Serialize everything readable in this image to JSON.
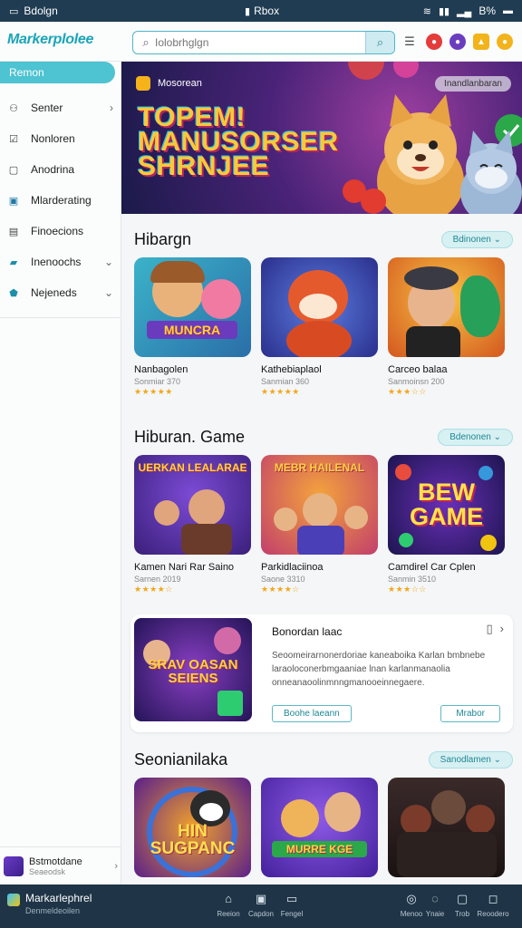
{
  "status_bar": {
    "left_text": "Bdolgn",
    "center_text": "Rbox",
    "battery_text": "B%"
  },
  "top_bar": {
    "logo": "Markerplolee",
    "search": {
      "value": "",
      "placeholder": "Iolobrhglgn"
    }
  },
  "sidebar": {
    "active": "Remon",
    "items": [
      {
        "label": "Senter",
        "icon": "person-icon",
        "has_chevron": "›"
      },
      {
        "label": "Nonloren",
        "icon": "checklist-icon",
        "has_chevron": ""
      },
      {
        "label": "Anodrina",
        "icon": "document-icon",
        "has_chevron": ""
      },
      {
        "label": "Mlarderating",
        "icon": "image-icon",
        "has_chevron": ""
      },
      {
        "label": "Finoecions",
        "icon": "finance-icon",
        "has_chevron": ""
      },
      {
        "label": "Inenoochs",
        "icon": "folder-icon",
        "has_chevron": "⌄"
      },
      {
        "label": "Nejeneds",
        "icon": "tag-icon",
        "has_chevron": "⌄"
      }
    ],
    "profile": {
      "name": "Bstmotdane",
      "sub": "Seaeodsk"
    }
  },
  "hero": {
    "tag": "Mosorean",
    "pill": "Inandlanbaran",
    "title": "TOPEM! MANUSORSER SHRNJEE"
  },
  "sections": [
    {
      "title": "Hibargn",
      "more": "Bdinonen",
      "cards": [
        {
          "name": "Nanbagolen",
          "sub": "Sonmiar 370",
          "stars": "★★★★★",
          "art_text": "MUNCRA"
        },
        {
          "name": "Kathebiaplaol",
          "sub": "Sanmian 360",
          "stars": "★★★★★",
          "art_text": ""
        },
        {
          "name": "Carceo balaa",
          "sub": "Sanmoinsn 200",
          "stars": "★★★☆☆",
          "art_text": ""
        }
      ]
    },
    {
      "title": "Hiburan. Game",
      "more": "Bdenonen",
      "cards": [
        {
          "name": "Kamen Nari Rar Saino",
          "sub": "Sarnen 2019",
          "stars": "★★★★☆",
          "art_text": "UERKAN LEALARAE"
        },
        {
          "name": "Parkidlaciinoa",
          "sub": "Saone 3310",
          "stars": "★★★★☆",
          "art_text": "MEBR HAILENAL"
        },
        {
          "name": "Camdirel Car Cplen",
          "sub": "Sanmin 3510",
          "stars": "★★★☆☆",
          "art_text": "BEW GAME"
        }
      ]
    },
    {
      "title": "Seonianilaka",
      "more": "Sanodlamen",
      "cards": [
        {
          "name": "",
          "sub": "",
          "stars": "",
          "art_text": "HIN SUGPANC"
        },
        {
          "name": "",
          "sub": "",
          "stars": "",
          "art_text": "MURRE KGE"
        },
        {
          "name": "",
          "sub": "",
          "stars": "",
          "art_text": ""
        }
      ]
    }
  ],
  "feature": {
    "title": "Bonordan laac",
    "desc": "Seoomeirarnonerdoriae kaneaboika Karlan bmbnebe laraoloconerbmgaaniae lnan karlanmanaolia onneanaoolinmnngmanooeinnegaere.",
    "btn_primary": "Boohe laeann",
    "btn_secondary": "Mrabor",
    "art_text": "SRAV OASAN SEIENS"
  },
  "bottom_bar": {
    "brand": "Markarlephrel",
    "brand_sub": "Denmeldeoilen",
    "nav_left": [
      {
        "label": "Reeion",
        "icon": "home-icon"
      },
      {
        "label": "Capdon",
        "icon": "calendar-icon"
      },
      {
        "label": "Fengel",
        "icon": "inbox-icon"
      }
    ],
    "nav_right": [
      {
        "label": "Menoo",
        "icon": "compass-icon"
      },
      {
        "label": "Ynaie",
        "icon": "chat-icon"
      },
      {
        "label": "Trob",
        "icon": "bookmark-icon"
      },
      {
        "label": "Reoodero",
        "icon": "message-icon"
      }
    ]
  },
  "colors": {
    "accent": "#4ec3d1",
    "topbar_bg": "#fbfcfc",
    "statusbar_bg": "#1f3c52",
    "bottombar_bg": "#1f3547",
    "star": "#f2a71b"
  }
}
